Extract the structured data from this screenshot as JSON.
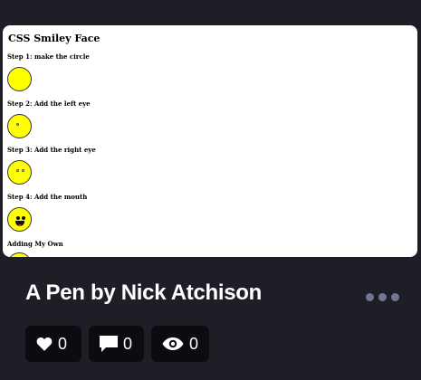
{
  "preview": {
    "heading": "CSS Smiley Face",
    "steps": [
      "Step 1: make the circle",
      "Step 2: Add the left eye",
      "Step 3: Add the right eye",
      "Step 4: Add the mouth",
      "Adding My Own"
    ]
  },
  "card": {
    "title": "A Pen by Nick Atchison",
    "stats": {
      "likes": "0",
      "comments": "0",
      "views": "0"
    }
  },
  "colors": {
    "background": "#1e1f26",
    "stat_background": "#0b0c0f",
    "face_yellow": "#ffff00",
    "more_dots": "#717790"
  },
  "icons": [
    "heart-icon",
    "comment-icon",
    "eye-icon",
    "more-icon"
  ]
}
